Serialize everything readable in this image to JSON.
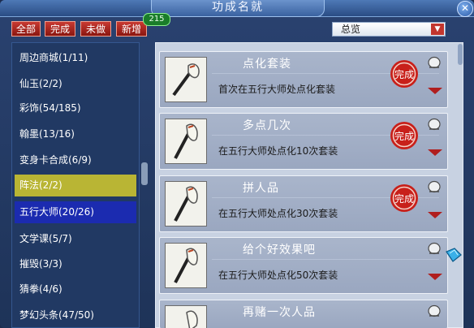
{
  "title": "功成名就",
  "filters": [
    "全部",
    "完成",
    "未做",
    "新增"
  ],
  "new_count": "215",
  "dropdown": {
    "value": "总览"
  },
  "categories": [
    "周边商城(1/11)",
    "仙玉(2/2)",
    "彩饰(54/185)",
    "翰墨(13/16)",
    "变身卡合成(6/9)",
    "阵法(2/2)",
    "五行大师(20/26)",
    "文学课(5/7)",
    "摧毁(3/3)",
    "猜拳(4/6)",
    "梦幻头条(47/50)"
  ],
  "achievements": [
    {
      "title": "点化套装",
      "desc": "首次在五行大师处点化套装",
      "seal": "完成"
    },
    {
      "title": "多点几次",
      "desc": "在五行大师处点化10次套装",
      "seal": "完成"
    },
    {
      "title": "拼人品",
      "desc": "在五行大师处点化30次套装",
      "seal": "完成"
    },
    {
      "title": "给个好效果吧",
      "desc": "在五行大师处点化50次套装",
      "seal": ""
    },
    {
      "title": "再赌一次人品",
      "desc": "",
      "seal": ""
    }
  ],
  "icons": {
    "close": "close-icon",
    "thumb": "axe-icon",
    "seal": "seal-icon",
    "bell": "bell-icon",
    "expand": "expand-icon",
    "dropdown": "dropdown-arrow-icon"
  },
  "colors": {
    "seal_red": "#c8201a",
    "selected_yellow": "#b9b534",
    "selected_blue": "#1b2bb0"
  }
}
